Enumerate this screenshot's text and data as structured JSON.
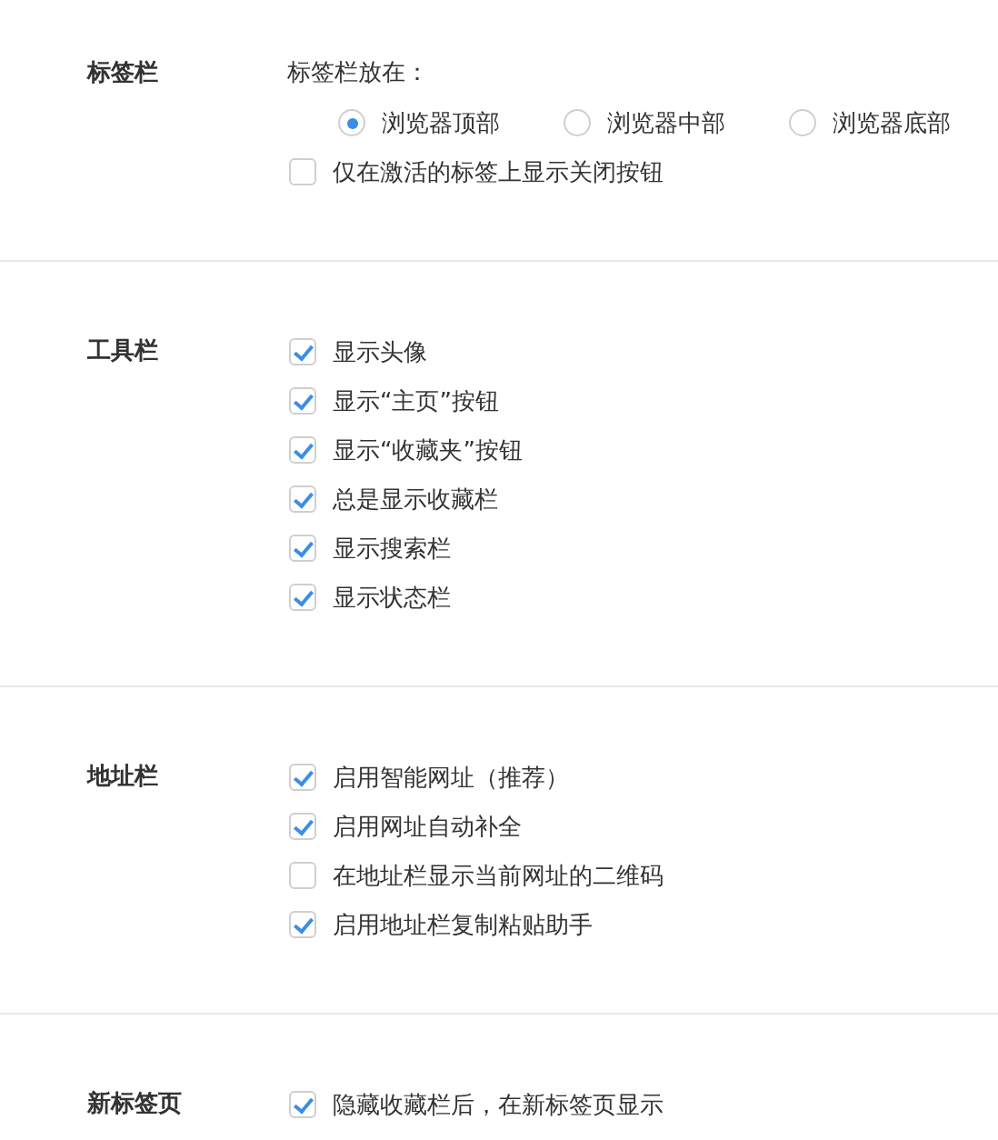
{
  "sections": [
    {
      "title": "标签栏",
      "items": [
        {
          "kind": "label",
          "text": "标签栏放在："
        },
        {
          "kind": "radio-group",
          "options": [
            {
              "label": "浏览器顶部",
              "selected": true
            },
            {
              "label": "浏览器中部",
              "selected": false
            },
            {
              "label": "浏览器底部",
              "selected": false
            }
          ]
        },
        {
          "kind": "checkbox",
          "label": "仅在激活的标签上显示关闭按钮",
          "checked": false
        }
      ]
    },
    {
      "title": "工具栏",
      "items": [
        {
          "kind": "checkbox",
          "label": "显示头像",
          "checked": true
        },
        {
          "kind": "checkbox",
          "label": "显示“主页”按钮",
          "checked": true
        },
        {
          "kind": "checkbox",
          "label": "显示“收藏夹”按钮",
          "checked": true
        },
        {
          "kind": "checkbox",
          "label": "总是显示收藏栏",
          "checked": true
        },
        {
          "kind": "checkbox",
          "label": "显示搜索栏",
          "checked": true
        },
        {
          "kind": "checkbox",
          "label": "显示状态栏",
          "checked": true
        }
      ]
    },
    {
      "title": "地址栏",
      "items": [
        {
          "kind": "checkbox",
          "label": "启用智能网址（推荐）",
          "checked": true
        },
        {
          "kind": "checkbox",
          "label": "启用网址自动补全",
          "checked": true
        },
        {
          "kind": "checkbox",
          "label": "在地址栏显示当前网址的二维码",
          "checked": false
        },
        {
          "kind": "checkbox",
          "label": "启用地址栏复制粘贴助手",
          "checked": true
        }
      ]
    },
    {
      "title": "新标签页",
      "items": [
        {
          "kind": "checkbox",
          "label": "隐藏收藏栏后，在新标签页显示",
          "checked": true
        }
      ]
    }
  ]
}
